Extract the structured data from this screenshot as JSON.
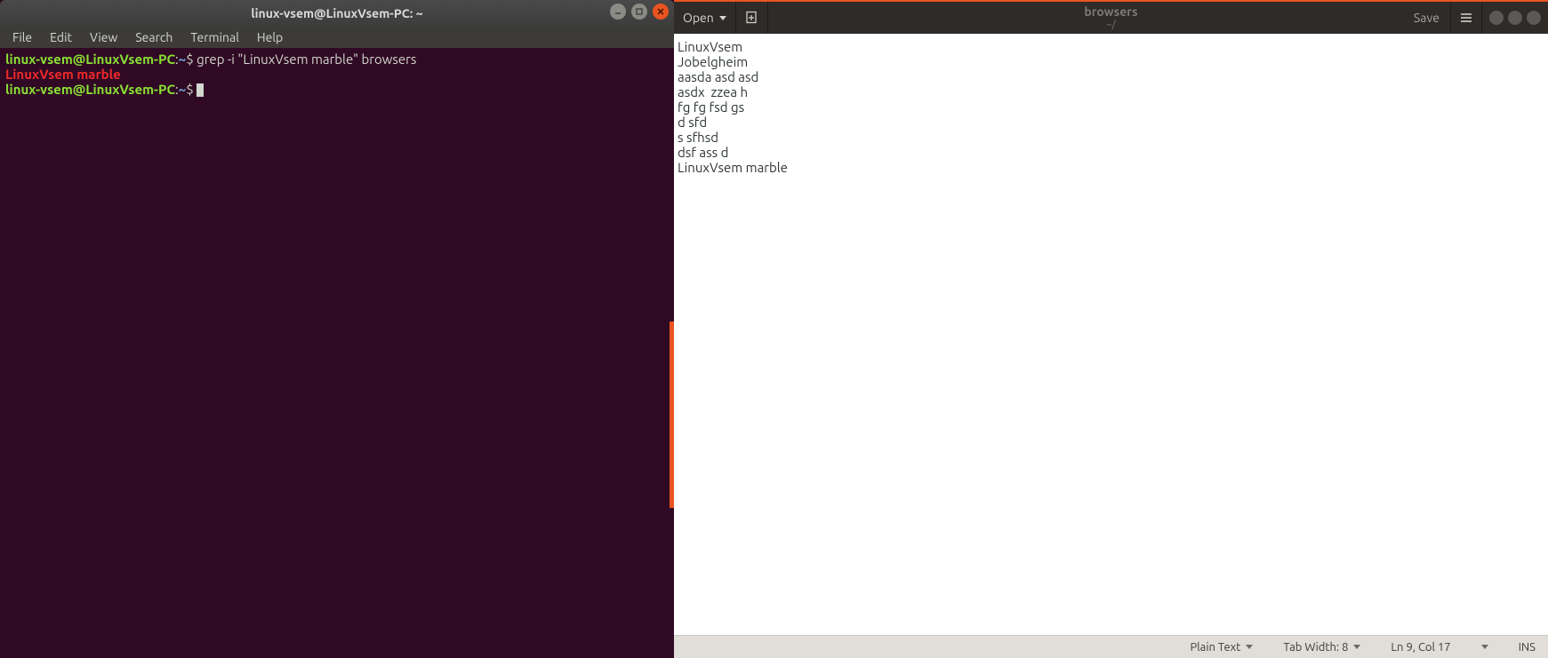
{
  "terminal": {
    "title": "linux-vsem@LinuxVsem-PC: ~",
    "menu": [
      "File",
      "Edit",
      "View",
      "Search",
      "Terminal",
      "Help"
    ],
    "prompt_user": "linux-vsem@LinuxVsem-PC",
    "prompt_sep": ":",
    "prompt_path": "~",
    "prompt_char": "$",
    "command": "grep -i \"LinuxVsem marble\" browsers",
    "output_match": "LinuxVsem marble"
  },
  "editor": {
    "open_label": "Open",
    "save_label": "Save",
    "doc_title": "browsers",
    "doc_path": "~/",
    "lines": [
      "LinuxVsem",
      "Jobelgheim",
      "aasda asd asd",
      "asdx  zzea h",
      "fg fg fsd gs",
      "d sfd",
      "s sfhsd",
      "dsf ass d",
      "LinuxVsem marble"
    ],
    "status": {
      "language": "Plain Text",
      "tab_width": "Tab Width: 8",
      "position": "Ln 9, Col 17",
      "insert_mode": "INS"
    }
  },
  "colors": {
    "term_bg": "#300a24",
    "ubuntu_orange": "#e95420"
  }
}
